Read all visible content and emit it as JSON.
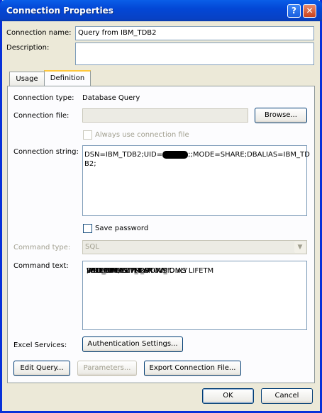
{
  "window": {
    "title": "Connection Properties",
    "help_glyph": "?",
    "close_glyph": "✕"
  },
  "connection_name": {
    "label": "Connection name:",
    "value": "Query from IBM_TDB2"
  },
  "description": {
    "label": "Description:",
    "value": ""
  },
  "tabs": [
    {
      "label": "Usage",
      "selected": false
    },
    {
      "label": "Definition",
      "selected": true
    }
  ],
  "definition": {
    "connection_type_label": "Connection type:",
    "connection_type_value": "Database Query",
    "connection_file_label": "Connection file:",
    "connection_file_value": "",
    "browse_button": "Browse...",
    "always_use_label": "Always use connection file",
    "connection_string_label": "Connection string:",
    "connection_string_line1_a": "DSN=IBM_TDB2;UID=",
    "connection_string_line1_b": ";;MODE=SHARE;DBALIAS=IBM_TD",
    "connection_string_line2": "B2;",
    "save_password_label": "Save password",
    "command_type_label": "Command type:",
    "command_type_value": "SQL",
    "command_text_label": "Command text:",
    "command_text_lines": [
      "SELECT LIFETM_PROV_ID AS LIFETM",
      ",FST_NM AS \"FIRST NM\"",
      ",MID_NM",
      "FROM PROV.PROV",
      "WHERE PROV_TYP = 'I'",
      "FETCH FIRST 10 ROWS ONLY",
      "WITH UR;"
    ],
    "excel_services_label": "Excel Services:",
    "auth_settings_button": "Authentication Settings...",
    "edit_query_button": "Edit Query...",
    "parameters_button": "Parameters...",
    "export_button": "Export Connection File..."
  },
  "footer": {
    "ok_button": "OK",
    "cancel_button": "Cancel"
  }
}
